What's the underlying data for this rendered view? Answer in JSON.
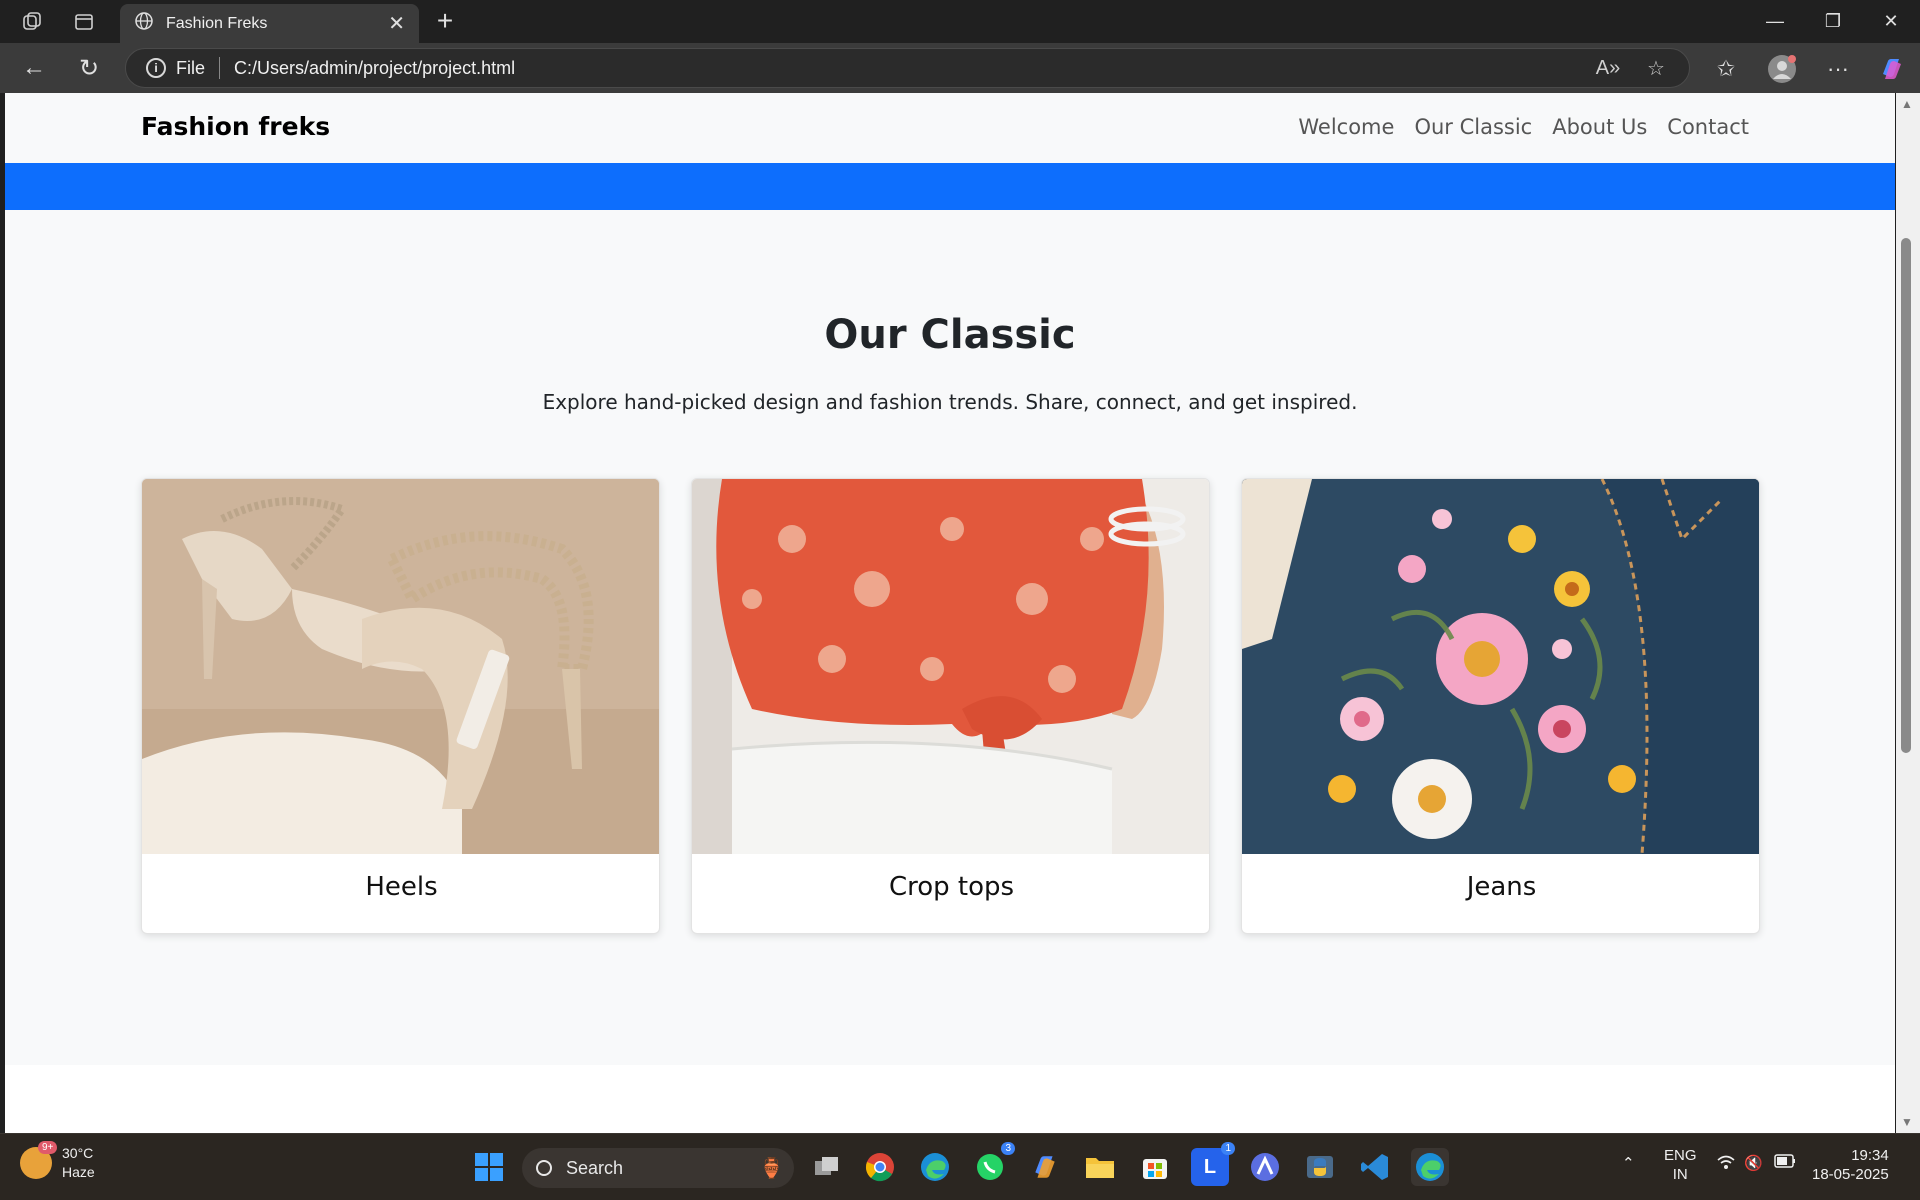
{
  "browser": {
    "tab_title": "Fashion Freks",
    "address_label": "File",
    "url": "C:/Users/admin/project/project.html"
  },
  "site": {
    "brand": "Fashion freks",
    "nav": [
      "Welcome",
      "Our Classic",
      "About Us",
      "Contact"
    ],
    "section_title": "Our Classic",
    "section_subtitle": "Explore hand-picked design and fashion trends. Share, connect, and get inspired.",
    "cards": [
      {
        "label": "Heels"
      },
      {
        "label": "Crop tops"
      },
      {
        "label": "Jeans"
      }
    ]
  },
  "taskbar": {
    "weather_temp": "30°C",
    "weather_desc": "Haze",
    "weather_badge": "9+",
    "search_label": "Search",
    "whatsapp_badge": "3",
    "l_badge": "1",
    "lang_top": "ENG",
    "lang_bottom": "IN",
    "time": "19:34",
    "date": "18-05-2025"
  },
  "colors": {
    "accent_band": "#0d6efd",
    "page_bg": "#f8f9fa"
  }
}
